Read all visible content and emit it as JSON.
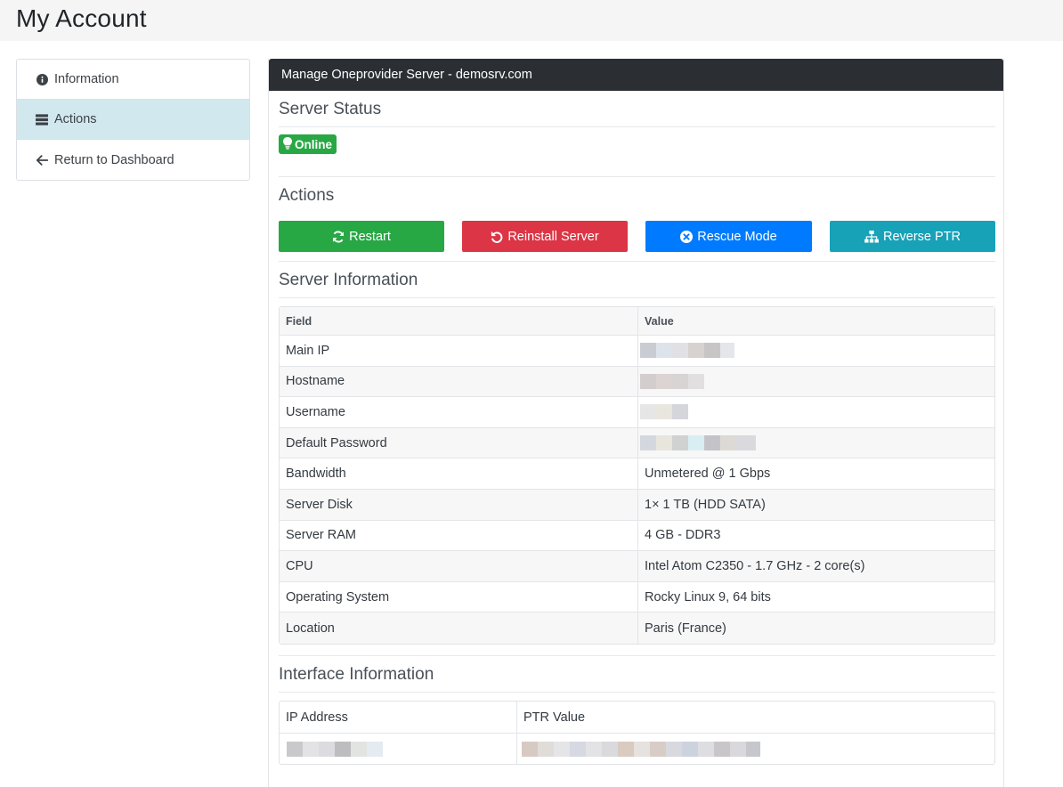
{
  "page": {
    "title": "My Account"
  },
  "sidebar": {
    "items": [
      {
        "label": "Information",
        "icon": "info-circle-icon"
      },
      {
        "label": "Actions",
        "icon": "server-icon",
        "active": true
      },
      {
        "label": "Return to Dashboard",
        "icon": "arrow-left-icon"
      }
    ]
  },
  "panel": {
    "title": "Manage Oneprovider Server - demosrv.com",
    "status": {
      "heading": "Server Status",
      "badge": "Online",
      "badge_color": "#28a745"
    },
    "actions": {
      "heading": "Actions",
      "buttons": [
        {
          "label": "Restart",
          "color": "#28a745",
          "icon": "sync-icon"
        },
        {
          "label": "Reinstall Server",
          "color": "#dc3545",
          "icon": "undo-icon"
        },
        {
          "label": "Rescue Mode",
          "color": "#007bff",
          "icon": "times-circle-icon"
        },
        {
          "label": "Reverse PTR",
          "color": "#17a2b8",
          "icon": "sitemap-icon"
        }
      ]
    },
    "server_info": {
      "heading": "Server Information",
      "columns": [
        "Field",
        "Value"
      ],
      "rows": [
        {
          "field": "Main IP",
          "value": ""
        },
        {
          "field": "Hostname",
          "value": ""
        },
        {
          "field": "Username",
          "value": ""
        },
        {
          "field": "Default Password",
          "value": ""
        },
        {
          "field": "Bandwidth",
          "value": "Unmetered @ 1 Gbps"
        },
        {
          "field": "Server Disk",
          "value": "1× 1 TB (HDD SATA)"
        },
        {
          "field": "Server RAM",
          "value": "4 GB - DDR3"
        },
        {
          "field": "CPU",
          "value": "Intel Atom C2350 - 1.7 GHz - 2 core(s)"
        },
        {
          "field": "Operating System",
          "value": "Rocky Linux 9, 64 bits"
        },
        {
          "field": "Location",
          "value": "Paris (France)"
        }
      ]
    },
    "interface_info": {
      "heading": "Interface Information",
      "columns": [
        "IP Address",
        "PTR Value"
      ]
    }
  }
}
